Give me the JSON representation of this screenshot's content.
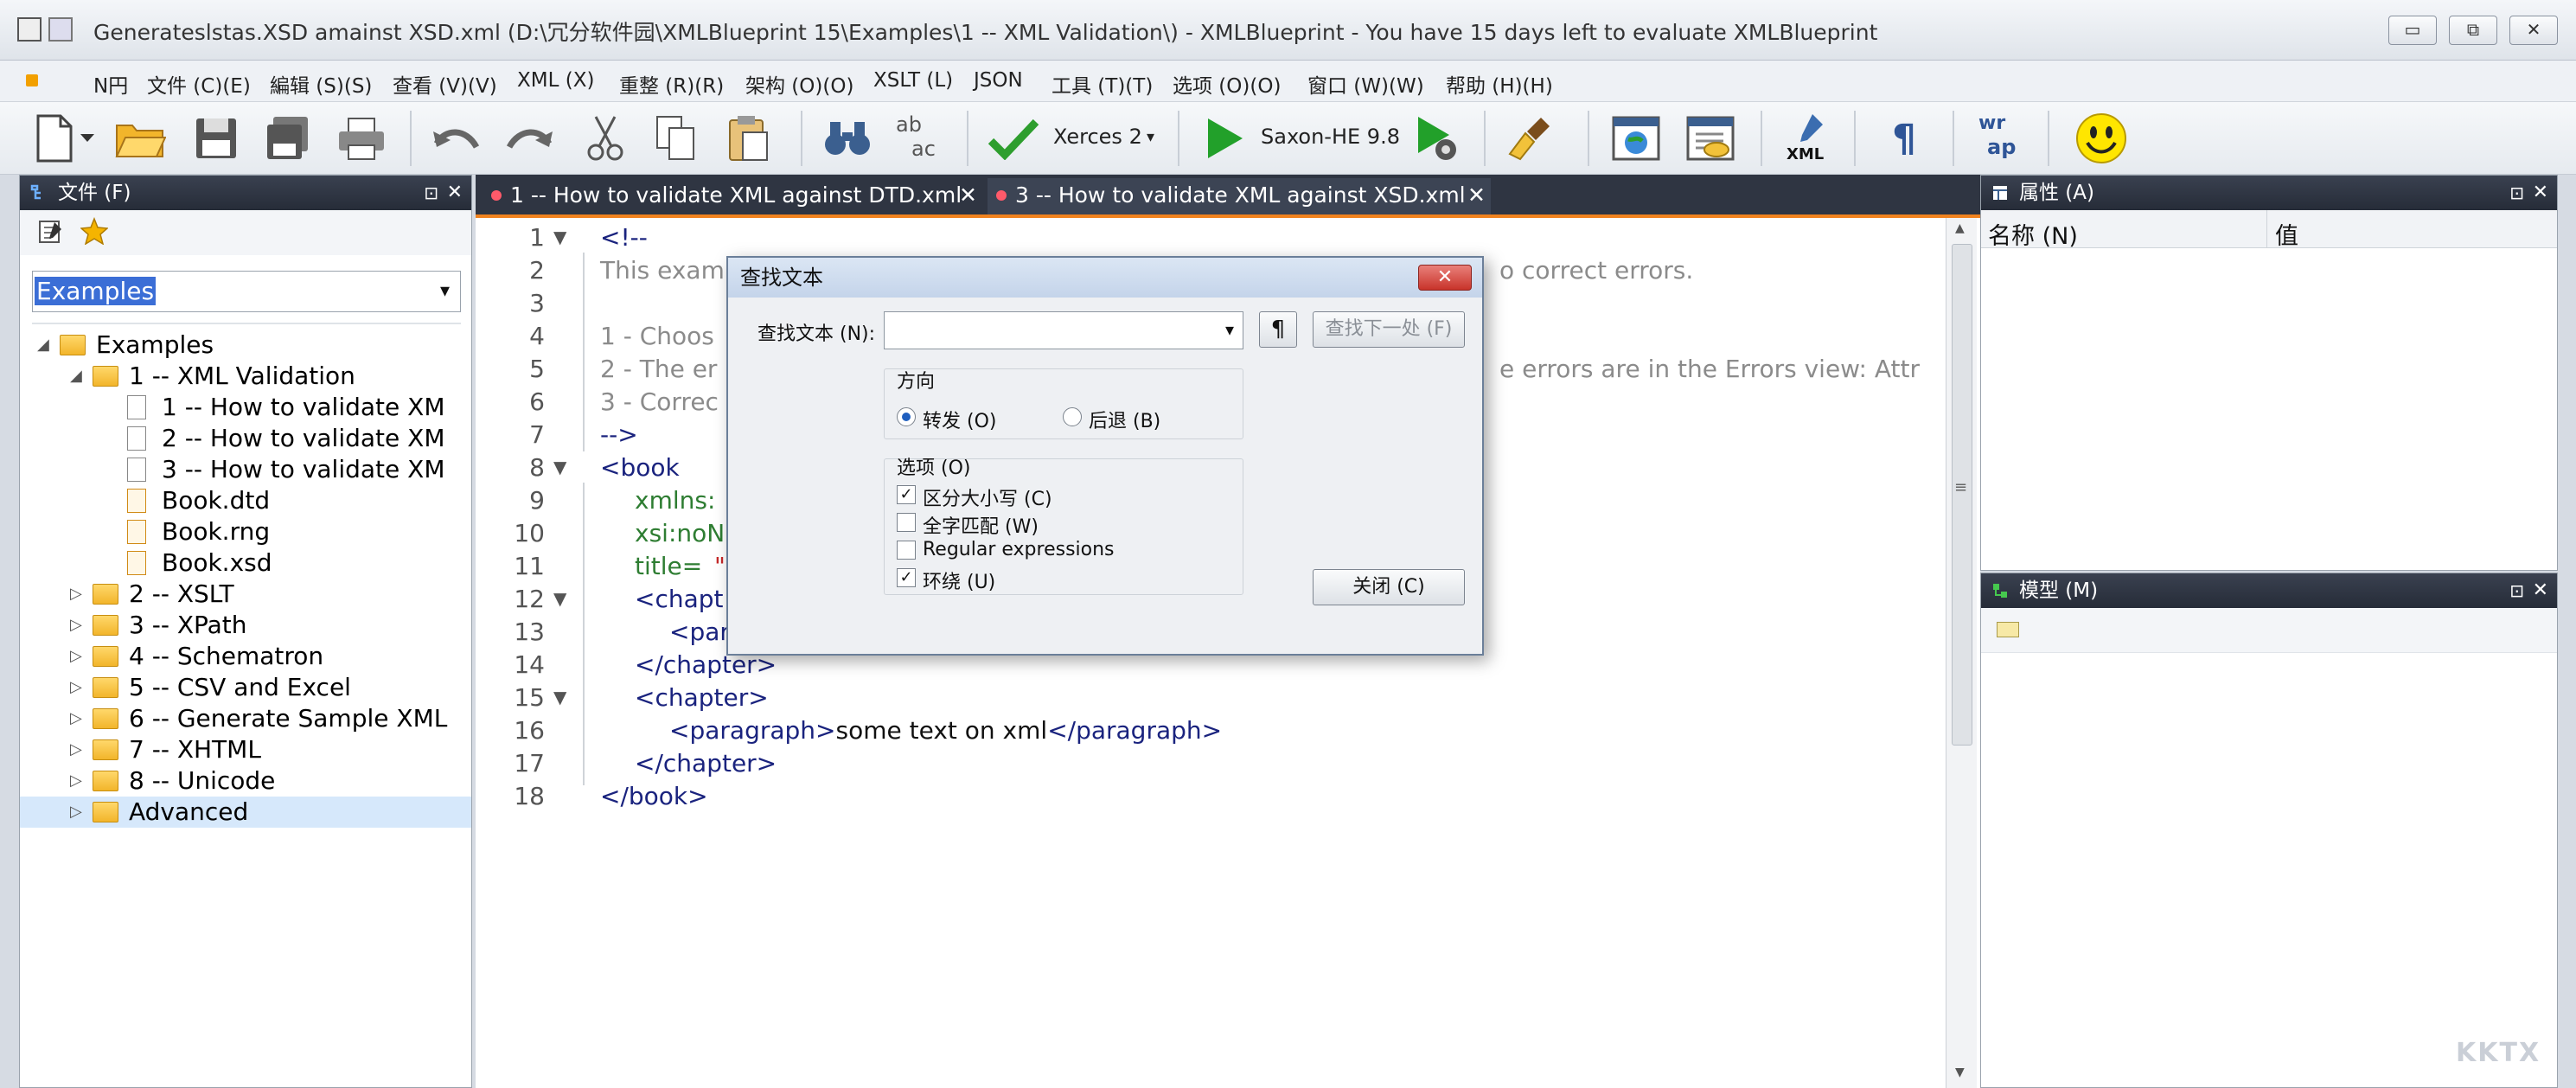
{
  "window": {
    "title": "Generateslstas.XSD amainst XSD.xml  (D:\\冗分软件园\\XMLBlueprint 15\\Examples\\1 -- XML Validation\\) - XMLBlueprint - You have 15 days left to evaluate XMLBlueprint",
    "minimize": "▭",
    "restore": "⧉",
    "close": "✕"
  },
  "menu": [
    "N円",
    "文件 (C)(E)",
    "編辑 (S)(S)",
    "查看 (V)(V)",
    "XML (X)",
    "重整 (R)(R)",
    "架构 (O)(O)",
    "XSLT (L)",
    "JSON",
    "工具 (T)(T)",
    "选项 (O)(O)",
    "窗口 (W)(W)",
    "帮助 (H)(H)"
  ],
  "toolbar": {
    "validator_label": "Xerces 2",
    "transformer_label": "Saxon-HE 9.8",
    "xml_label": "XML",
    "wrap_label_top": "wr",
    "wrap_label_bottom": "ap",
    "pilcrow": "¶",
    "ab_top": "ab",
    "ab_bottom": "ac",
    "dropdown_arrow": "▾"
  },
  "files_panel": {
    "title": "文件 (F)",
    "pin": "⊡",
    "close": "✕",
    "combo_value": "Examples",
    "combo_arrow": "▾",
    "tree": [
      {
        "label": "Examples",
        "level": 0,
        "kind": "folder",
        "expanded": true
      },
      {
        "label": "1 -- XML Validation",
        "level": 1,
        "kind": "folder",
        "expanded": true
      },
      {
        "label": "1 -- How to validate XM",
        "level": 2,
        "kind": "doc"
      },
      {
        "label": "2 -- How to validate XM",
        "level": 2,
        "kind": "doc"
      },
      {
        "label": "3 -- How to validate XM",
        "level": 2,
        "kind": "doc"
      },
      {
        "label": "Book.dtd",
        "level": 2,
        "kind": "docx"
      },
      {
        "label": "Book.rng",
        "level": 2,
        "kind": "docx"
      },
      {
        "label": "Book.xsd",
        "level": 2,
        "kind": "docx"
      },
      {
        "label": "2 -- XSLT",
        "level": 1,
        "kind": "folder"
      },
      {
        "label": "3 -- XPath",
        "level": 1,
        "kind": "folder"
      },
      {
        "label": "4 -- Schematron",
        "level": 1,
        "kind": "folder"
      },
      {
        "label": "5 -- CSV and Excel",
        "level": 1,
        "kind": "folder"
      },
      {
        "label": "6 -- Generate Sample XML",
        "level": 1,
        "kind": "folder"
      },
      {
        "label": "7 -- XHTML",
        "level": 1,
        "kind": "folder"
      },
      {
        "label": "8 -- Unicode",
        "level": 1,
        "kind": "folder"
      },
      {
        "label": "Advanced",
        "level": 1,
        "kind": "folder",
        "selected": true
      }
    ]
  },
  "editor": {
    "tabs": [
      {
        "label": "1 -- How to validate XML against DTD.xml",
        "close": "✕"
      },
      {
        "label": "3 -- How to validate XML against XSD.xml",
        "close": "✕"
      }
    ],
    "line_numbers": [
      "1",
      "2",
      "3",
      "4",
      "5",
      "6",
      "7",
      "8",
      "9",
      "10",
      "11",
      "12",
      "13",
      "14",
      "15",
      "16",
      "17",
      "18"
    ],
    "lines": {
      "l1": "<!--",
      "l2": "This exam",
      "l2b": "o correct errors.",
      "l4": "1 - Choos",
      "l5": "2 - The er",
      "l5b": "e errors are in the Errors view: Attr",
      "l6": "3 - Correc",
      "l7": "-->",
      "l8": "<book",
      "l9": "xmlns:",
      "l10": "xsi:noN",
      "l11a": "title=",
      "l11b": "\"a",
      "l12": "<chapt",
      "l13": "<par",
      "l14": "</chapter>",
      "l15": "<chapter>",
      "l16a": "<paragraph>",
      "l16b": "some text on xml",
      "l16c": "</paragraph>",
      "l17": "</chapter>",
      "l18": "</book>"
    }
  },
  "find_dialog": {
    "title": "查找文本",
    "close": "✕",
    "find_label": "查找文本 (N):",
    "find_value": "",
    "combo_arrow": "▾",
    "pilcrow": "¶",
    "find_next": "查找下一处 (F)",
    "direction_label": "方向",
    "forward": "转发 (O)",
    "backward": "后退 (B)",
    "options_label": "选项 (O)",
    "opt_case": "区分大小写 (C)",
    "opt_whole": "全字匹配 (W)",
    "opt_regex": "Regular expressions",
    "opt_wrap": "环绕 (U)",
    "check_mark": "✓",
    "close_button": "关闭 (C)"
  },
  "properties_panel": {
    "title": "属性 (A)",
    "pin": "⊡",
    "close": "✕",
    "col_name": "名称 (N)",
    "col_value": "值"
  },
  "model_panel": {
    "title": "模型 (M)",
    "pin": "⊡",
    "close": "✕"
  },
  "scroll": {
    "up": "▲",
    "down": "▼",
    "grip": "≡"
  },
  "tree_arrows": {
    "expanded": "◢",
    "collapsed": "▷",
    "fold_open": "▼"
  },
  "watermark": "KKTX"
}
